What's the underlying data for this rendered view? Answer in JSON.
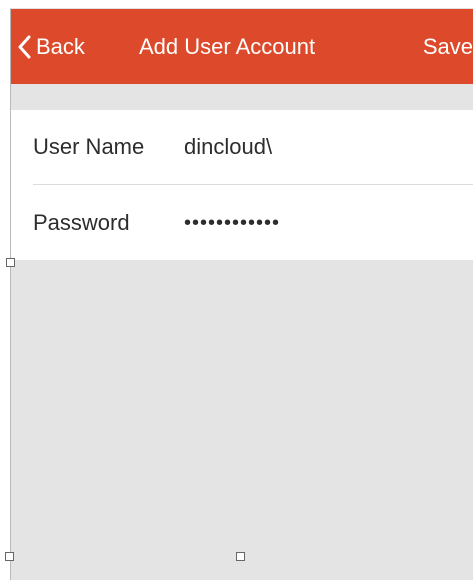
{
  "navbar": {
    "back_label": "Back",
    "title": "Add User Account",
    "save_label": "Save",
    "back_icon": "chevron-left-icon"
  },
  "form": {
    "username": {
      "label": "User Name",
      "value": "dincloud\\"
    },
    "password": {
      "label": "Password",
      "value": "••••••••••••"
    }
  },
  "colors": {
    "accent": "#dd4a2b",
    "background": "#e4e4e4",
    "form_background": "#ffffff",
    "text": "#2d2d2d"
  }
}
